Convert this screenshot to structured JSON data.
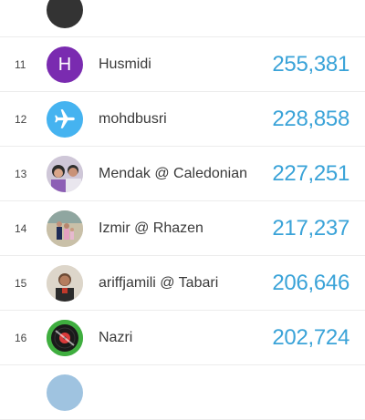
{
  "leaderboard": {
    "rows": [
      {
        "rank": "",
        "name": "",
        "score": "",
        "avatar": "photo-partial"
      },
      {
        "rank": "11",
        "name": "Husmidi",
        "score": "255,381",
        "avatar": "letter",
        "avatar_letter": "H"
      },
      {
        "rank": "12",
        "name": "mohdbusri",
        "score": "228,858",
        "avatar": "airplane-icon"
      },
      {
        "rank": "13",
        "name": "Mendak @ Caledonian",
        "score": "227,251",
        "avatar": "photo"
      },
      {
        "rank": "14",
        "name": "Izmir @ Rhazen",
        "score": "217,237",
        "avatar": "photo"
      },
      {
        "rank": "15",
        "name": "ariffjamili @ Tabari",
        "score": "206,646",
        "avatar": "photo"
      },
      {
        "rank": "16",
        "name": "Nazri",
        "score": "202,724",
        "avatar": "vinyl-record-icon"
      },
      {
        "rank": "",
        "name": "",
        "score": "",
        "avatar": "photo-partial"
      }
    ]
  }
}
